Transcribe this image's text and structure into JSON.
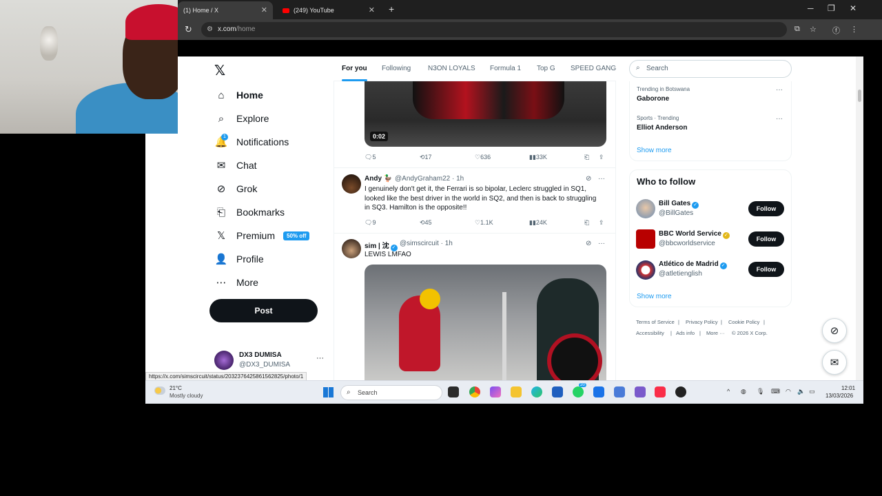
{
  "browser": {
    "tabs": [
      {
        "title": "(1) Home / X",
        "active": true
      },
      {
        "title": "(249) YouTube",
        "active": false
      }
    ],
    "new_tab": "+",
    "url_host": "x.com",
    "url_path": "/home",
    "window_controls": {
      "minimize": "─",
      "maximize": "❐",
      "close": "✕"
    },
    "status_url": "https://x.com/simscircuit/status/2032376425861562825/photo/1"
  },
  "nav": {
    "items": [
      {
        "label": "Home",
        "icon": "⌂"
      },
      {
        "label": "Explore",
        "icon": "⌕"
      },
      {
        "label": "Notifications",
        "icon": "🔔"
      },
      {
        "label": "Chat",
        "icon": "✉"
      },
      {
        "label": "Grok",
        "icon": "⊘"
      },
      {
        "label": "Bookmarks",
        "icon": "⎗"
      },
      {
        "label": "Premium",
        "icon": "𝕏"
      },
      {
        "label": "Profile",
        "icon": "👤"
      },
      {
        "label": "More",
        "icon": "⋯"
      }
    ],
    "notifications_badge": "1",
    "premium_badge": "50% off",
    "post_label": "Post",
    "account": {
      "name": "DX3 DUMISA",
      "handle": "@DX3_DUMISA",
      "more": "···"
    }
  },
  "feed_tabs": [
    "For you",
    "Following",
    "N3ON LOYALS",
    "Formula 1",
    "Top G",
    "SPEED GANG"
  ],
  "feed": {
    "video_time": "0:02",
    "post1_actions": {
      "replies": "5",
      "reposts": "17",
      "likes": "636",
      "views": "33K"
    },
    "post2": {
      "name": "Andy",
      "emoji": "🦆",
      "handle": "@AndyGraham22",
      "time": "· 1h",
      "text": "I genuinely don't get it, the Ferrari is so bipolar, Leclerc struggled in SQ1, looked like the best driver in the world in SQ2, and then is back to struggling in SQ3. Hamilton is the opposite!!",
      "actions": {
        "replies": "9",
        "reposts": "45",
        "likes": "1.1K",
        "views": "24K"
      }
    },
    "post3": {
      "name": "sim | 沈",
      "handle": "@simscircuit",
      "time": "· 1h",
      "text": "LEWIS LMFAO"
    }
  },
  "sidebar": {
    "search_placeholder": "Search",
    "trends": [
      {
        "meta": "Trending in Botswana",
        "name": "Gaborone"
      },
      {
        "meta": "Sports · Trending",
        "name": "Elliot Anderson"
      }
    ],
    "trends_show_more": "Show more",
    "who_to_follow_title": "Who to follow",
    "who_to_follow": [
      {
        "name": "Bill Gates",
        "handle": "@BillGates",
        "badge": "blue"
      },
      {
        "name": "BBC World Service",
        "handle": "@bbcworldservice",
        "badge": "gold"
      },
      {
        "name": "Atlético de Madrid",
        "handle": "@atletienglish",
        "badge": "blue"
      }
    ],
    "follow_label": "Follow",
    "who_show_more": "Show more",
    "footer": [
      "Terms of Service",
      "|",
      "Privacy Policy",
      "|",
      "Cookie Policy",
      "|",
      "Accessibility",
      "|",
      "Ads info",
      "|",
      "More ···",
      "© 2026 X Corp."
    ]
  },
  "taskbar": {
    "weather_temp": "21°C",
    "weather_desc": "Mostly cloudy",
    "search_label": "Search",
    "time": "12:01",
    "date": "13/03/2026",
    "whatsapp_badge": "20"
  },
  "colors": {
    "accent": "#1d9bf0",
    "text": "#0f1419",
    "muted": "#536471"
  }
}
